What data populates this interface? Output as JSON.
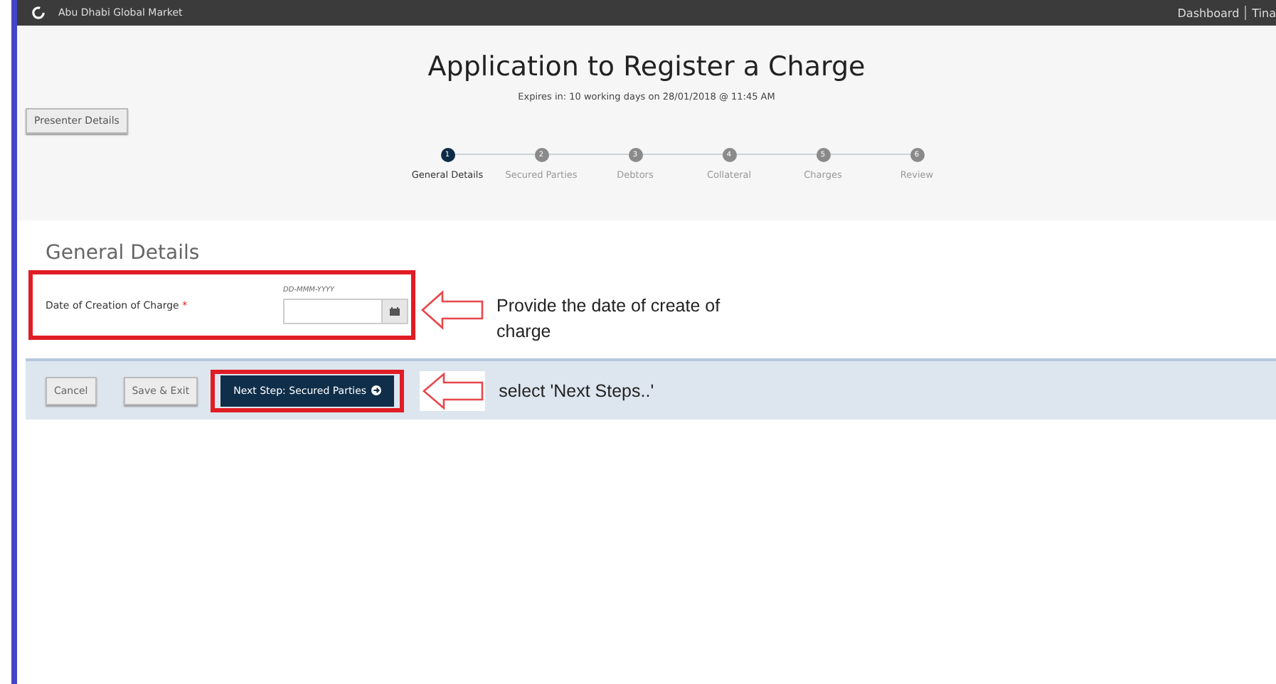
{
  "top_bar": {
    "site_name": "Abu Dhabi Global Market",
    "links": [
      "Dashboard",
      "Tina"
    ]
  },
  "header": {
    "title": "Application to Register a Charge",
    "expiry": "Expires in: 10 working days on 28/01/2018 @ 11:45 AM",
    "presenter_button": "Presenter Details"
  },
  "steps": [
    {
      "number": "1",
      "label": "General Details",
      "selected": true
    },
    {
      "number": "2",
      "label": "Secured Parties",
      "selected": false
    },
    {
      "number": "3",
      "label": "Debtors",
      "selected": false
    },
    {
      "number": "4",
      "label": "Collateral",
      "selected": false
    },
    {
      "number": "5",
      "label": "Charges",
      "selected": false
    },
    {
      "number": "6",
      "label": "Review",
      "selected": false
    }
  ],
  "section": {
    "title": "General Details",
    "field": {
      "label": "Date of Creation of Charge",
      "required_mark": "*",
      "format_hint": "DD-MMM-YYYY"
    }
  },
  "actions": [
    {
      "label": "Cancel",
      "kind": "secondary"
    },
    {
      "label": "Save & Exit",
      "kind": "secondary"
    },
    {
      "label": "Next Step: Secured Parties",
      "kind": "primary"
    }
  ],
  "annotations": [
    {
      "text": "Provide the date of create of charge"
    },
    {
      "text": "select 'Next Steps..'"
    }
  ]
}
